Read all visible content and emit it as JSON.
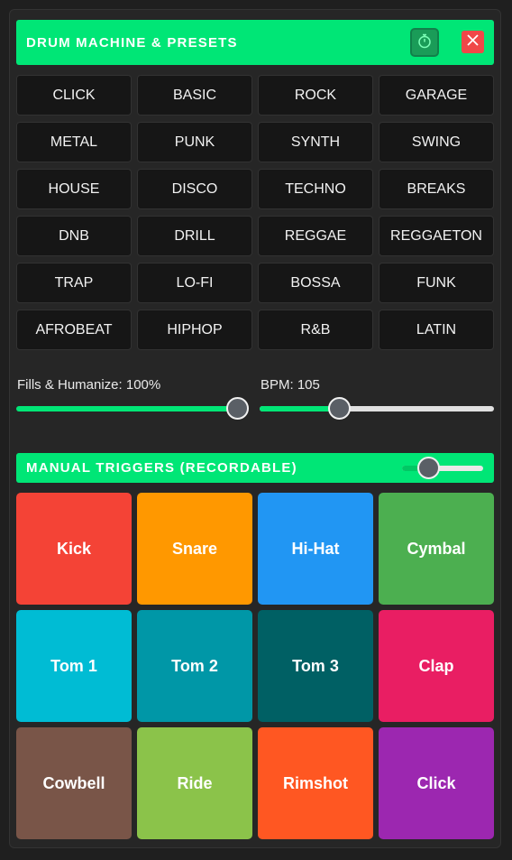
{
  "header": {
    "title": "DRUM MACHINE & PRESETS",
    "timer_icon": "stopwatch-icon",
    "close_icon": "close-icon"
  },
  "presets": [
    "CLICK",
    "BASIC",
    "ROCK",
    "GARAGE",
    "METAL",
    "PUNK",
    "SYNTH",
    "SWING",
    "HOUSE",
    "DISCO",
    "TECHNO",
    "BREAKS",
    "DNB",
    "DRILL",
    "REGGAE",
    "REGGAETON",
    "TRAP",
    "LO-FI",
    "BOSSA",
    "FUNK",
    "AFROBEAT",
    "HIPHOP",
    "R&B",
    "LATIN"
  ],
  "controls": {
    "fills_label": "Fills & Humanize: 100%",
    "fills_value": 1.0,
    "bpm_label": "BPM: 105",
    "bpm_value_fraction": 0.34
  },
  "triggers": {
    "title": "MANUAL TRIGGERS (RECORDABLE)",
    "volume_fraction": 0.33,
    "pads": [
      {
        "label": "Kick",
        "color": "#f44336"
      },
      {
        "label": "Snare",
        "color": "#ff9800"
      },
      {
        "label": "Hi-Hat",
        "color": "#2196f3"
      },
      {
        "label": "Cymbal",
        "color": "#4caf50"
      },
      {
        "label": "Tom 1",
        "color": "#00bcd4"
      },
      {
        "label": "Tom 2",
        "color": "#0097a7"
      },
      {
        "label": "Tom 3",
        "color": "#006064"
      },
      {
        "label": "Clap",
        "color": "#e91e63"
      },
      {
        "label": "Cowbell",
        "color": "#795548"
      },
      {
        "label": "Ride",
        "color": "#8bc34a"
      },
      {
        "label": "Rimshot",
        "color": "#ff5722"
      },
      {
        "label": "Click",
        "color": "#9c27b0"
      }
    ]
  },
  "colors": {
    "accent": "#00e676",
    "track_empty": "#e0e0e0"
  }
}
